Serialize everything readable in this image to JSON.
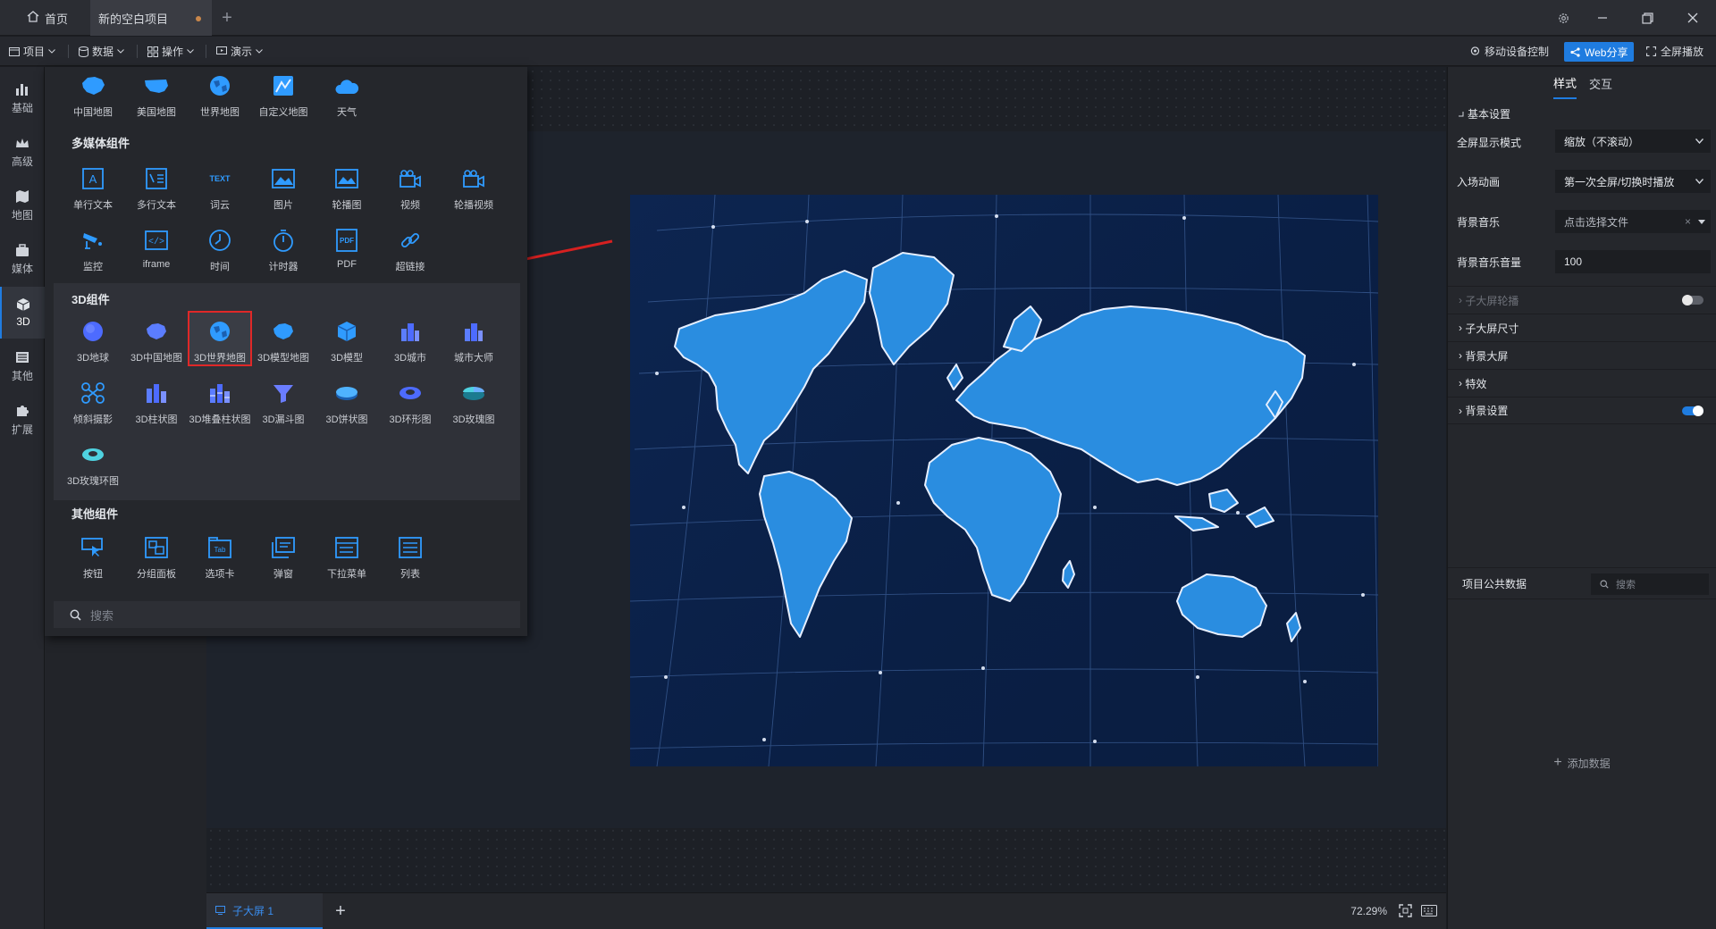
{
  "titlebar": {
    "home_tab": "首页",
    "project_tab": "新的空白项目"
  },
  "toolbar": {
    "menus": [
      "项目",
      "数据",
      "操作",
      "演示"
    ],
    "right": {
      "device_control": "移动设备控制",
      "web_share": "Web分享",
      "fullscreen": "全屏播放"
    }
  },
  "rail": {
    "items": [
      "基础",
      "高级",
      "地图",
      "媒体",
      "3D",
      "其他",
      "扩展"
    ]
  },
  "popup": {
    "map_items": [
      "中国地图",
      "美国地图",
      "世界地图",
      "自定义地图",
      "天气"
    ],
    "sections": {
      "media": "多媒体组件",
      "three_d": "3D组件",
      "other": "其他组件"
    },
    "media_items": [
      "单行文本",
      "多行文本",
      "词云",
      "图片",
      "轮播图",
      "视频",
      "轮播视频",
      "监控",
      "iframe",
      "时间",
      "计时器",
      "PDF",
      "超链接"
    ],
    "three_d_items": [
      "3D地球",
      "3D中国地图",
      "3D世界地图",
      "3D模型地图",
      "3D模型",
      "3D城市",
      "城市大师",
      "倾斜摄影",
      "3D柱状图",
      "3D堆叠柱状图",
      "3D漏斗图",
      "3D饼状图",
      "3D环形图",
      "3D玫瑰图",
      "3D玫瑰环图"
    ],
    "other_items": [
      "按钮",
      "分组面板",
      "选项卡",
      "弹窗",
      "下拉菜单",
      "列表"
    ],
    "search_placeholder": "搜索",
    "icon_texts": {
      "text_glyph": "A",
      "wordcloud_glyph": "TEXT",
      "pdf_glyph": "PDF",
      "tab_glyph": "Tab",
      "iframe_glyph": "</>"
    }
  },
  "bottombar": {
    "sub_tab": "子大屏 1",
    "zoom": "72.29%"
  },
  "rightpanel": {
    "tabs": [
      "样式",
      "交互"
    ],
    "basic_settings": "基本设置",
    "rows": [
      {
        "label": "全屏显示模式",
        "value": "缩放（不滚动）"
      },
      {
        "label": "入场动画",
        "value": "第一次全屏/切换时播放"
      },
      {
        "label": "背景音乐",
        "value": "点击选择文件"
      },
      {
        "label": "背景音乐音量",
        "value": "100"
      }
    ],
    "collapse": [
      "子大屏轮播",
      "子大屏尺寸",
      "背景大屏",
      "特效",
      "背景设置"
    ],
    "toggles": {
      "sub_screen_carousel": false,
      "background_settings": true
    },
    "public_data": "项目公共数据",
    "public_search_placeholder": "搜索",
    "add_data": "添加数据"
  },
  "colors": {
    "accent": "#1f7ce0",
    "selection_red": "#e02828",
    "arrow_red": "#d62020",
    "map_ocean": "#0d2550",
    "map_land": "#2a8de0"
  }
}
